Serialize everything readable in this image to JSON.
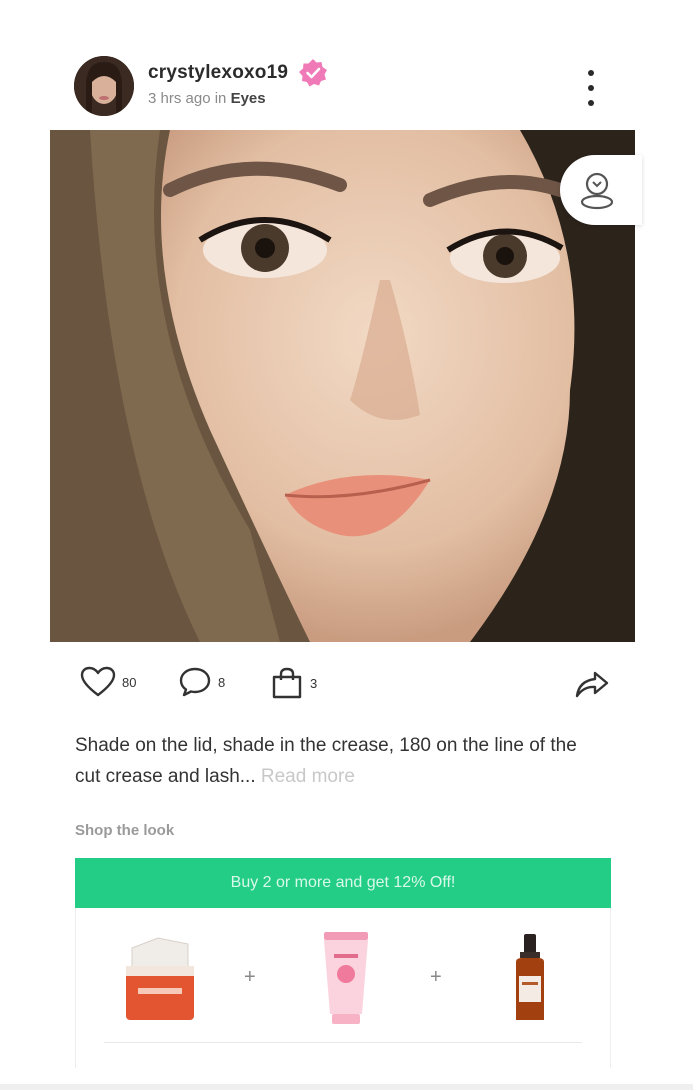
{
  "post": {
    "username": "crystylexoxo19",
    "time_ago": "3 hrs ago",
    "in_text": "in",
    "category": "Eyes"
  },
  "actions": {
    "likes": "80",
    "comments": "8",
    "shop_count": "3"
  },
  "caption": {
    "text": "Shade on the lid, shade in the crease, 180 on the line of the cut crease and lash...",
    "read_more": "Read more"
  },
  "shop": {
    "title": "Shop the look",
    "promo": "Buy 2 or more and get 12% Off!",
    "plus": "+"
  },
  "icons": {
    "verified": "verified-badge-icon",
    "more": "more-vertical-icon",
    "face_scan": "face-scan-icon",
    "like": "heart-icon",
    "comment": "comment-icon",
    "shop": "shopping-bag-icon",
    "share": "share-icon"
  },
  "colors": {
    "accent_green": "#23cd85",
    "verified_pink": "#f07ab8"
  }
}
